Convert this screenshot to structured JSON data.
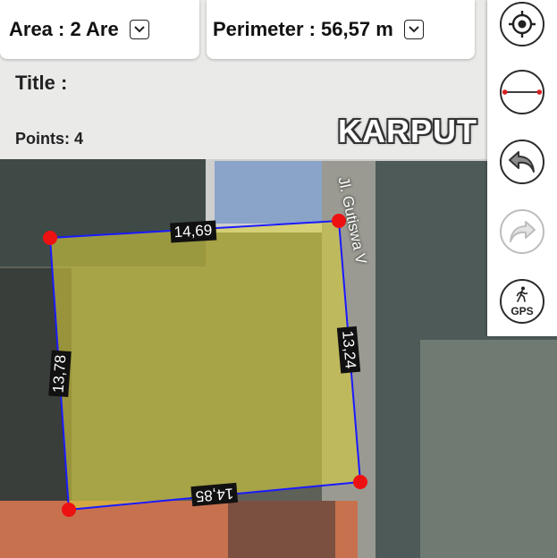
{
  "header": {
    "area_label": "Area : 2 Are",
    "perimeter_label": "Perimeter : 56,57 m",
    "title_label": "Title :",
    "points_label": "Points: 4"
  },
  "brand": {
    "text": "KARPUT"
  },
  "map": {
    "street_label": "Jl. Gutiswa V"
  },
  "polygon": {
    "edges": [
      "14,69",
      "13,24",
      "14,85",
      "13,78"
    ],
    "stroke_color": "#1a1aff",
    "fill_color": "#d8cf3c",
    "vertex_color": "#ee1111"
  },
  "sidebar": {
    "tools": [
      {
        "name": "locate-me",
        "icon": "crosshair-icon",
        "enabled": true
      },
      {
        "name": "line-measure",
        "icon": "ruler-line-icon",
        "enabled": true
      },
      {
        "name": "undo",
        "icon": "undo-icon",
        "enabled": true
      },
      {
        "name": "redo",
        "icon": "redo-icon",
        "enabled": false
      },
      {
        "name": "gps",
        "icon": "gps-walk-icon",
        "enabled": true,
        "label": "GPS"
      }
    ]
  }
}
